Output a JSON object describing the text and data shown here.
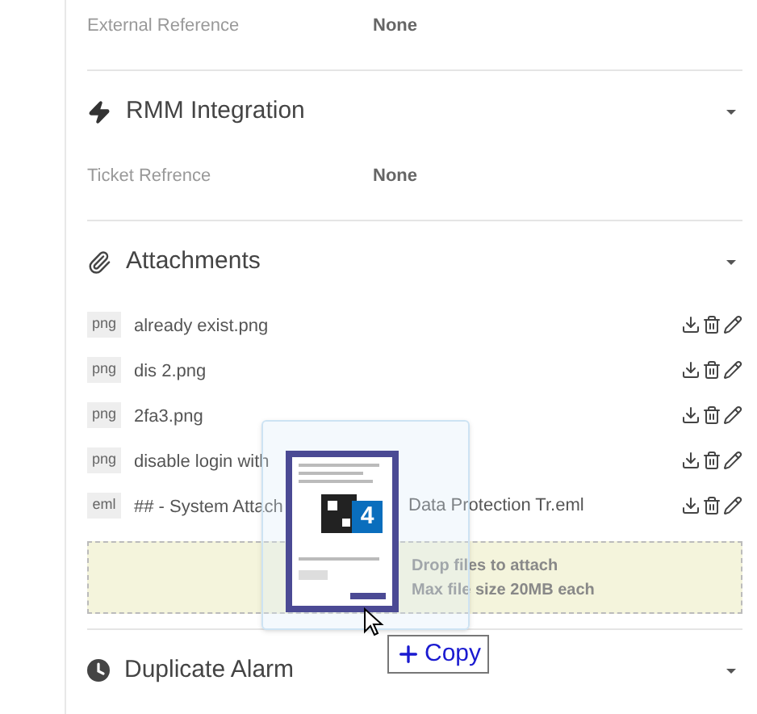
{
  "fields_top": [
    {
      "label": "External Reference",
      "value": "None"
    }
  ],
  "sections": [
    {
      "title": "RMM Integration",
      "expanded": true
    },
    {
      "title": "Attachments",
      "expanded": true
    },
    {
      "title": "Duplicate Alarm",
      "expanded": true
    }
  ],
  "rmm_fields": [
    {
      "label": "Ticket Refrence",
      "value": "None"
    }
  ],
  "attachments": [
    {
      "type": "png",
      "name": "already exist.png"
    },
    {
      "type": "png",
      "name": "dis 2.png"
    },
    {
      "type": "png",
      "name": "2fa3.png"
    },
    {
      "type": "png",
      "name": "disable login with"
    },
    {
      "type": "eml",
      "name": "## - System Attach",
      "name_tail": "Data Protection Tr.eml"
    }
  ],
  "dropzone": {
    "line1": "Drop files to attach",
    "line2": "Max file size 20MB each"
  },
  "drag_ghost": {
    "count": "4",
    "action": "Copy"
  }
}
